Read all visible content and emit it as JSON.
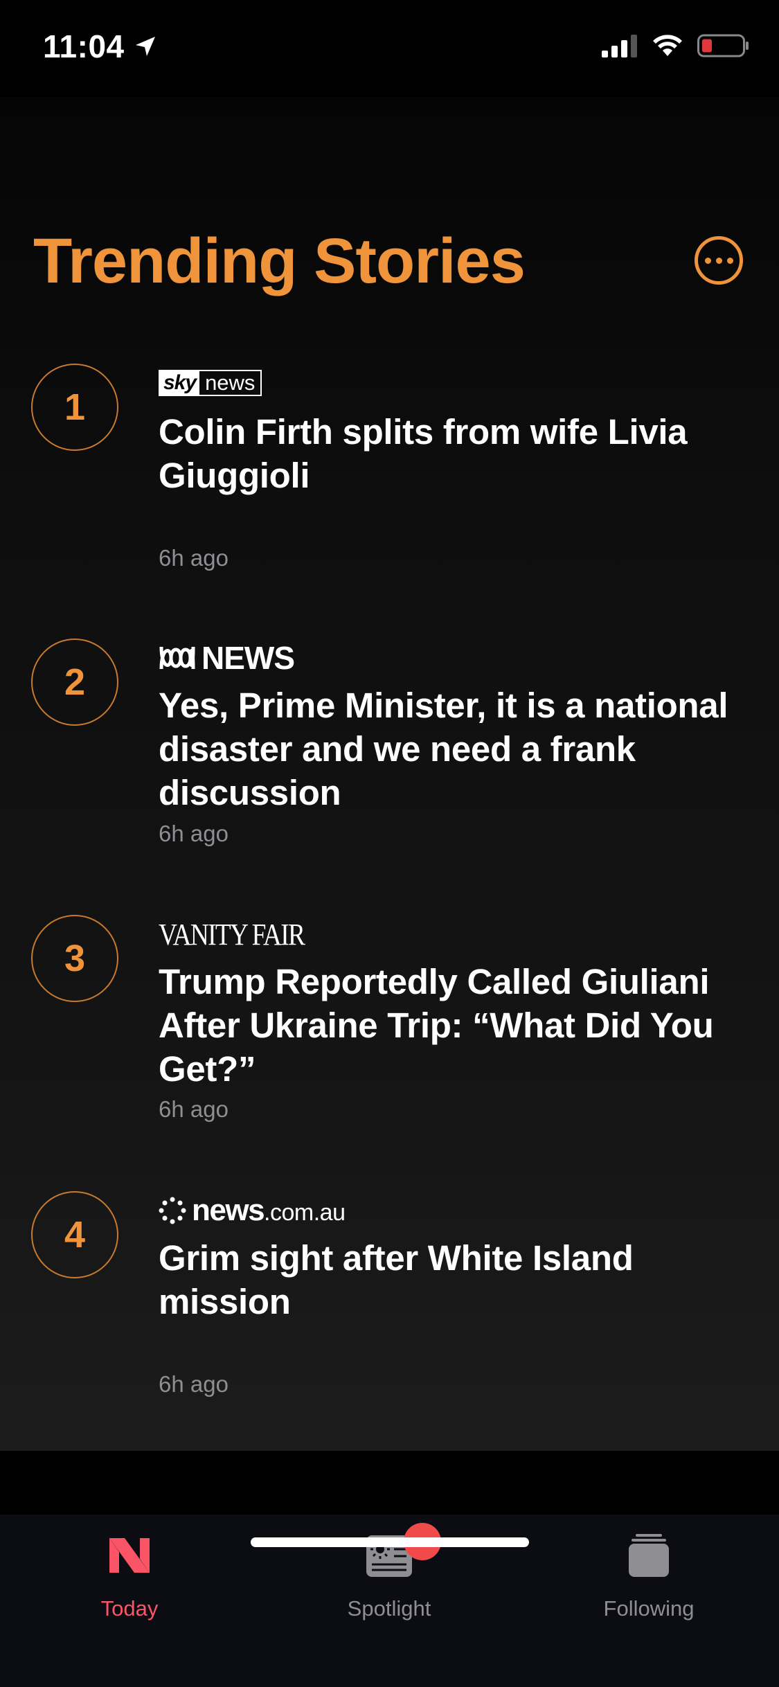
{
  "status_bar": {
    "time": "11:04",
    "icons": [
      "location-arrow-icon",
      "cellular-signal-icon",
      "wifi-icon",
      "battery-low-icon"
    ],
    "battery_color": "#e0383c"
  },
  "card": {
    "title": "Trending Stories",
    "accent_color": "#f0943b",
    "more_icon": "ellipsis-circle-icon",
    "stories": [
      {
        "rank": "1",
        "source_logo": "sky-news-logo",
        "source_parts": [
          "sky",
          "news"
        ],
        "headline": "Colin Firth splits from wife Livia Giuggioli",
        "time": "6h ago"
      },
      {
        "rank": "2",
        "source_logo": "abc-news-logo",
        "source_text": "NEWS",
        "headline": "Yes, Prime Minister, it is a national disaster and we need a frank discussion",
        "time": "6h ago"
      },
      {
        "rank": "3",
        "source_logo": "vanity-fair-logo",
        "source_text": "VANITY FAIR",
        "headline": "Trump Reportedly Called Giuliani After Ukraine Trip: “What Did You Get?”",
        "time": "6h ago"
      },
      {
        "rank": "4",
        "source_logo": "news-com-au-logo",
        "source_parts": [
          "news",
          ".com.au"
        ],
        "headline": "Grim sight after White Island mission",
        "time": "6h ago"
      }
    ]
  },
  "tab_bar": {
    "tabs": [
      {
        "label": "Today",
        "icon": "apple-news-icon",
        "active": true
      },
      {
        "label": "Spotlight",
        "icon": "spotlight-newspaper-icon",
        "active": false,
        "badge": true
      },
      {
        "label": "Following",
        "icon": "following-stack-icon",
        "active": false
      }
    ],
    "active_color": "#fa5566",
    "inactive_color": "#8e8e93",
    "badge_color": "#f04a4a"
  }
}
